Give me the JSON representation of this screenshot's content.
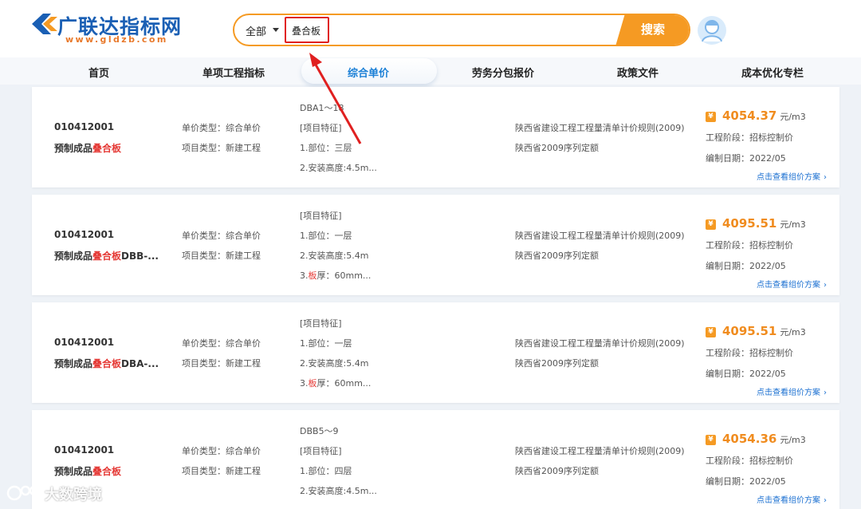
{
  "header": {
    "logo_title": "广联达指标网",
    "logo_sub": "www.gldzb.com",
    "search": {
      "scope": "全部",
      "value": "叠合板",
      "button": "搜索"
    }
  },
  "nav": {
    "items": [
      "首页",
      "单项工程指标",
      "综合单价",
      "劳务分包报价",
      "政策文件",
      "成本优化专栏"
    ],
    "active_index": 2
  },
  "cards": [
    {
      "code": "010412001",
      "name_prefix": "预制成品",
      "name_highlight": "叠合板",
      "name_suffix": "",
      "price_type": "单价类型：综合单价",
      "project_type": "项目类型：新建工程",
      "feature_top": "DBA1～18",
      "features": [
        {
          "pre": "[项目特征]",
          "hl": "",
          "post": ""
        },
        {
          "pre": "1.部位：三层",
          "hl": "",
          "post": ""
        },
        {
          "pre": "2.安装高度:4.5m...",
          "hl": "",
          "post": ""
        }
      ],
      "rule1": "陕西省建设工程工程量清单计价规则(2009)",
      "rule2": "陕西省2009序列定额",
      "price": "4054.37",
      "unit": "元/m3",
      "stage": "工程阶段：招标控制价",
      "date": "编制日期：2022/05",
      "link": "点击查看组价方案"
    },
    {
      "code": "010412001",
      "name_prefix": "预制成品",
      "name_highlight": "叠合板",
      "name_suffix": "DBB-...",
      "price_type": "单价类型：综合单价",
      "project_type": "项目类型：新建工程",
      "feature_top": "",
      "features": [
        {
          "pre": "[项目特征]",
          "hl": "",
          "post": ""
        },
        {
          "pre": "1.部位：一层",
          "hl": "",
          "post": ""
        },
        {
          "pre": "2.安装高度:5.4m",
          "hl": "",
          "post": ""
        },
        {
          "pre": "3.",
          "hl": "板",
          "post": "厚：60mm..."
        }
      ],
      "rule1": "陕西省建设工程工程量清单计价规则(2009)",
      "rule2": "陕西省2009序列定额",
      "price": "4095.51",
      "unit": "元/m3",
      "stage": "工程阶段：招标控制价",
      "date": "编制日期：2022/05",
      "link": "点击查看组价方案"
    },
    {
      "code": "010412001",
      "name_prefix": "预制成品",
      "name_highlight": "叠合板",
      "name_suffix": "DBA-...",
      "price_type": "单价类型：综合单价",
      "project_type": "项目类型：新建工程",
      "feature_top": "",
      "features": [
        {
          "pre": "[项目特征]",
          "hl": "",
          "post": ""
        },
        {
          "pre": "1.部位：一层",
          "hl": "",
          "post": ""
        },
        {
          "pre": "2.安装高度:5.4m",
          "hl": "",
          "post": ""
        },
        {
          "pre": "3.",
          "hl": "板",
          "post": "厚：60mm..."
        }
      ],
      "rule1": "陕西省建设工程工程量清单计价规则(2009)",
      "rule2": "陕西省2009序列定额",
      "price": "4095.51",
      "unit": "元/m3",
      "stage": "工程阶段：招标控制价",
      "date": "编制日期：2022/05",
      "link": "点击查看组价方案"
    },
    {
      "code": "010412001",
      "name_prefix": "预制成品",
      "name_highlight": "叠合板",
      "name_suffix": "",
      "price_type": "单价类型：综合单价",
      "project_type": "项目类型：新建工程",
      "feature_top": "DBB5～9",
      "features": [
        {
          "pre": "[项目特征]",
          "hl": "",
          "post": ""
        },
        {
          "pre": "1.部位：四层",
          "hl": "",
          "post": ""
        },
        {
          "pre": "2.安装高度:4.5m...",
          "hl": "",
          "post": ""
        }
      ],
      "rule1": "陕西省建设工程工程量清单计价规则(2009)",
      "rule2": "陕西省2009序列定额",
      "price": "4054.36",
      "unit": "元/m3",
      "stage": "工程阶段：招标控制价",
      "date": "编制日期：2022/05",
      "link": "点击查看组价方案"
    }
  ],
  "watermark": "大数跨境",
  "colors": {
    "brand_blue": "#1a5fb4",
    "accent_orange": "#f59a23",
    "highlight_red": "#e53935",
    "link_blue": "#1a6fd1"
  }
}
